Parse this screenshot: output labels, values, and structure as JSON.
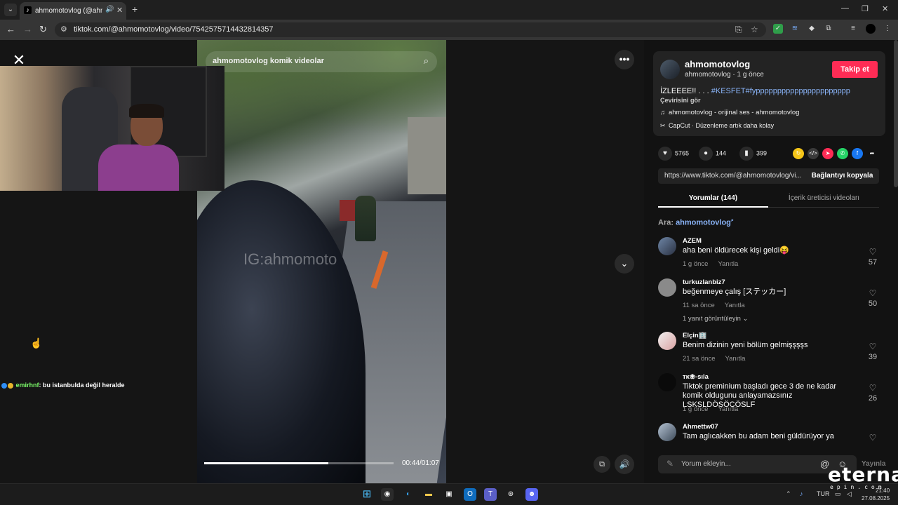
{
  "browser": {
    "tab_title": "ahmomotovlog (@ahmomotovlog)",
    "url": "tiktok.com/@ahmomotovlog/video/7542575714432814357"
  },
  "video": {
    "search_text": "ahmomotovlog komik videolar",
    "watermark": "IG:ahmomoto",
    "time": "00:44/01:07",
    "progress": 0.657
  },
  "stream_chat": {
    "username": "emirhnf",
    "message": ": bu istanbulda değil heralde"
  },
  "author": {
    "name": "ahmomotovlog",
    "sub": "ahmomotovlog · 1 g önce",
    "follow_label": "Takip et"
  },
  "post": {
    "caption_text": "İZLEEEE!! . . . ",
    "caption_tags": "#KESFET#fypppppppppppppppppppppp",
    "translate_label": "Çevirisini gör",
    "music": "ahmomotovlog - orijinal ses - ahmomotovlog",
    "capcut": "CapCut · Düzenleme artık daha kolay"
  },
  "stats": {
    "likes": "5765",
    "comments": "144",
    "saves": "399"
  },
  "share_link": {
    "url": "https://www.tiktok.com/@ahmomotovlog/vi...",
    "copy_label": "Bağlantıyı kopyala"
  },
  "tabs": {
    "comments": "Yorumlar (144)",
    "creator_videos": "İçerik üreticisi videoları"
  },
  "search_hint": {
    "prefix": "Ara: ",
    "query": "ahmomotovlog"
  },
  "comments": [
    {
      "user": "AZEM",
      "text": "aha beni öldürecek kişi geldi😝",
      "time": "1 g önce",
      "reply": "Yanıtla",
      "likes": "57"
    },
    {
      "user": "turkuzlanbiz7",
      "text": "beğenmeye çalış [ステッカー]",
      "time": "11 sa önce",
      "reply": "Yanıtla",
      "likes": "50",
      "view_replies": "1 yanıt görüntüleyin ⌄"
    },
    {
      "user": "Elçin🏢",
      "text": "Benim dizinin yeni bölüm gelmişşşşs",
      "time": "21 sa önce",
      "reply": "Yanıtla",
      "likes": "39"
    },
    {
      "user": "ᴛᴋ❀-sıla",
      "text": "Tiktok preminium başladı gece 3 de ne kadar komik oldugunu anlayamazsınız LSKSLDÖSÖCÖSLF",
      "time": "1 g önce",
      "reply": "Yanıtla",
      "likes": "26"
    },
    {
      "user": "Ahmettw07",
      "text": "Tam aglıcakken bu adam beni güldürüyor ya",
      "time": "",
      "reply": "",
      "likes": ""
    }
  ],
  "comment_input": {
    "placeholder": "Yorum ekleyin...",
    "post_label": "Yayınla"
  },
  "taskbar": {
    "lang": "TUR",
    "time": "21:40",
    "date": "27.08.2025"
  },
  "overlay_brand": {
    "name": "eternal",
    "sub": "epin.com"
  },
  "colors": {
    "follow": "#fe2c55",
    "hashtag": "#8ab4f8",
    "chat_username": "#7dff6b"
  }
}
